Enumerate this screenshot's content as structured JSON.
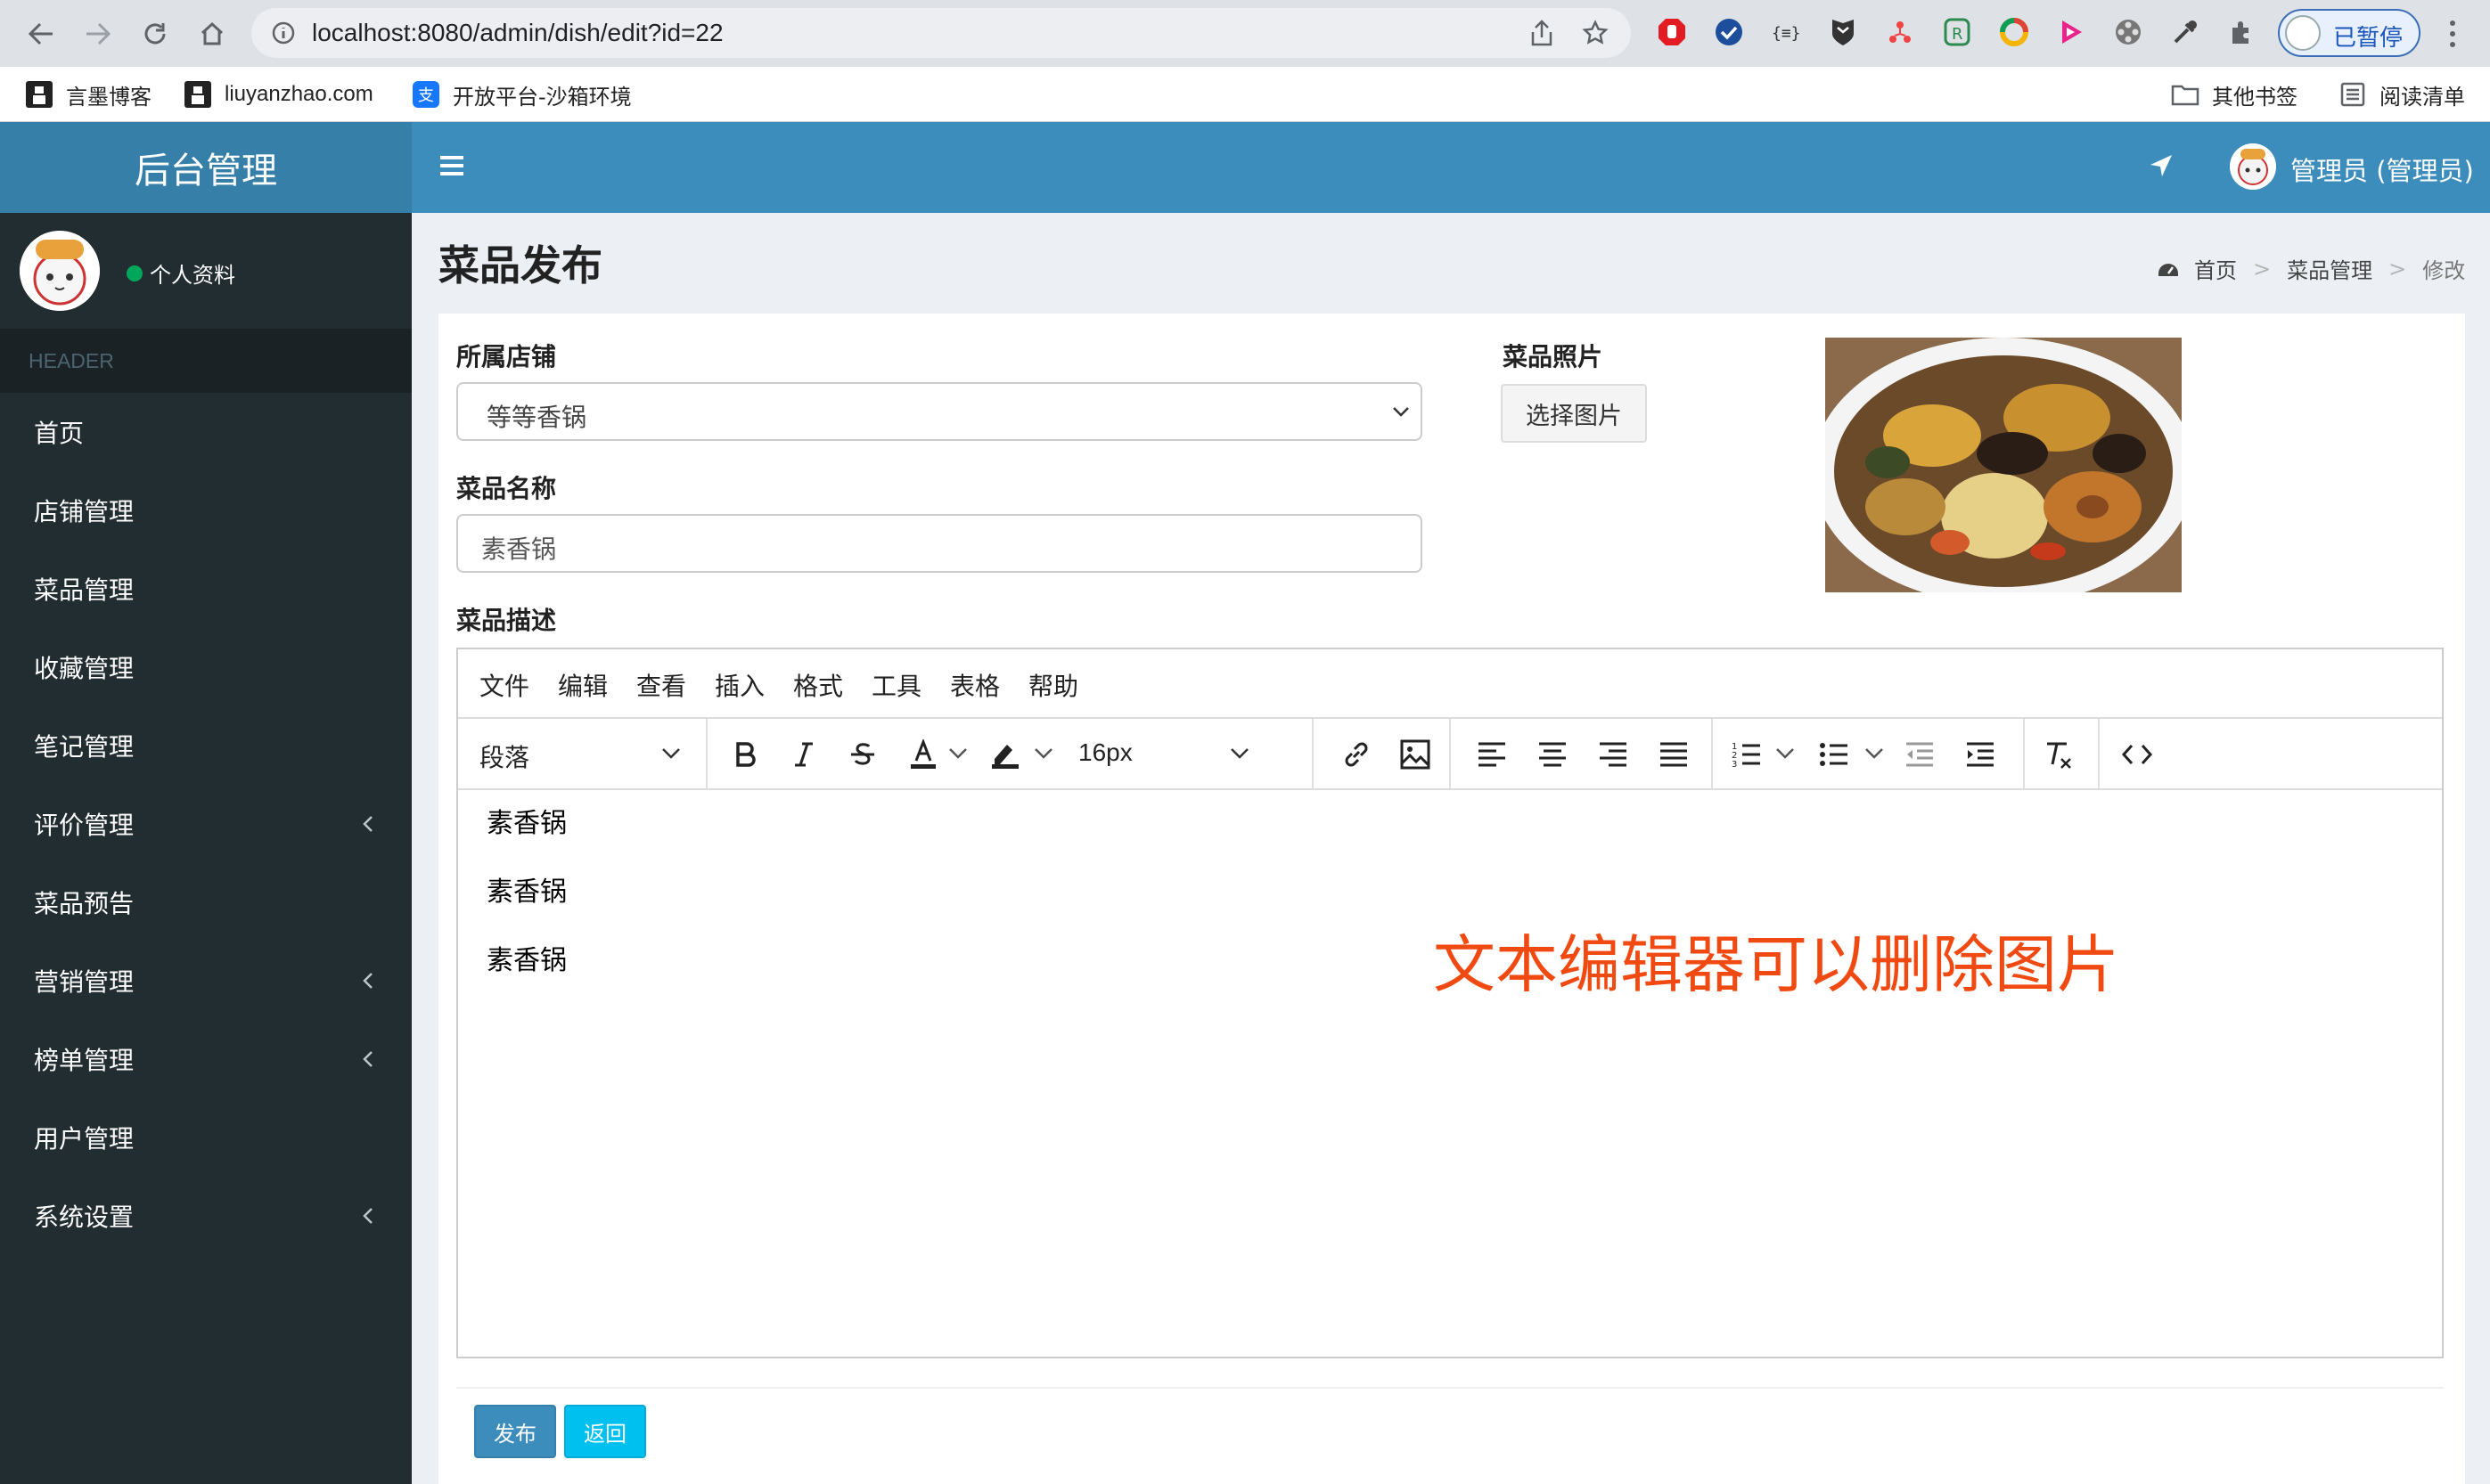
{
  "browser": {
    "url": "localhost:8080/admin/dish/edit?id=22",
    "profile_label": "已暂停",
    "bookmarks": [
      "言墨博客",
      "liuyanzhao.com",
      "开放平台-沙箱环境"
    ],
    "bookmarks_right": [
      "其他书签",
      "阅读清单"
    ]
  },
  "app": {
    "logo": "后台管理",
    "user_name": "管理员 (管理员)"
  },
  "sidebar": {
    "status": "个人资料",
    "header": "HEADER",
    "items": [
      {
        "label": "首页"
      },
      {
        "label": "店铺管理"
      },
      {
        "label": "菜品管理"
      },
      {
        "label": "收藏管理"
      },
      {
        "label": "笔记管理"
      },
      {
        "label": "评价管理"
      },
      {
        "label": "菜品预告"
      },
      {
        "label": "营销管理"
      },
      {
        "label": "榜单管理"
      },
      {
        "label": "用户管理"
      },
      {
        "label": "系统设置"
      }
    ]
  },
  "page": {
    "title": "菜品发布",
    "breadcrumb": [
      "首页",
      "菜品管理",
      "修改"
    ]
  },
  "form": {
    "shop_label": "所属店铺",
    "shop_value": "等等香锅",
    "name_label": "菜品名称",
    "name_value": "素香锅",
    "photo_label": "菜品照片",
    "choose_button": "选择图片",
    "desc_label": "菜品描述"
  },
  "editor": {
    "menus": [
      "文件",
      "编辑",
      "查看",
      "插入",
      "格式",
      "工具",
      "表格",
      "帮助"
    ],
    "block_format": "段落",
    "font_size": "16px",
    "paragraphs": [
      "素香锅",
      "素香锅",
      "素香锅"
    ],
    "annotation": "文本编辑器可以删除图片"
  },
  "buttons": {
    "publish": "发布",
    "back": "返回"
  },
  "colors": {
    "header_blue": "#3c8dbc",
    "logo_blue": "#367fa9",
    "sidebar_dark": "#222d32",
    "annotation": "#f04a12",
    "info_button": "#00c0ef"
  }
}
